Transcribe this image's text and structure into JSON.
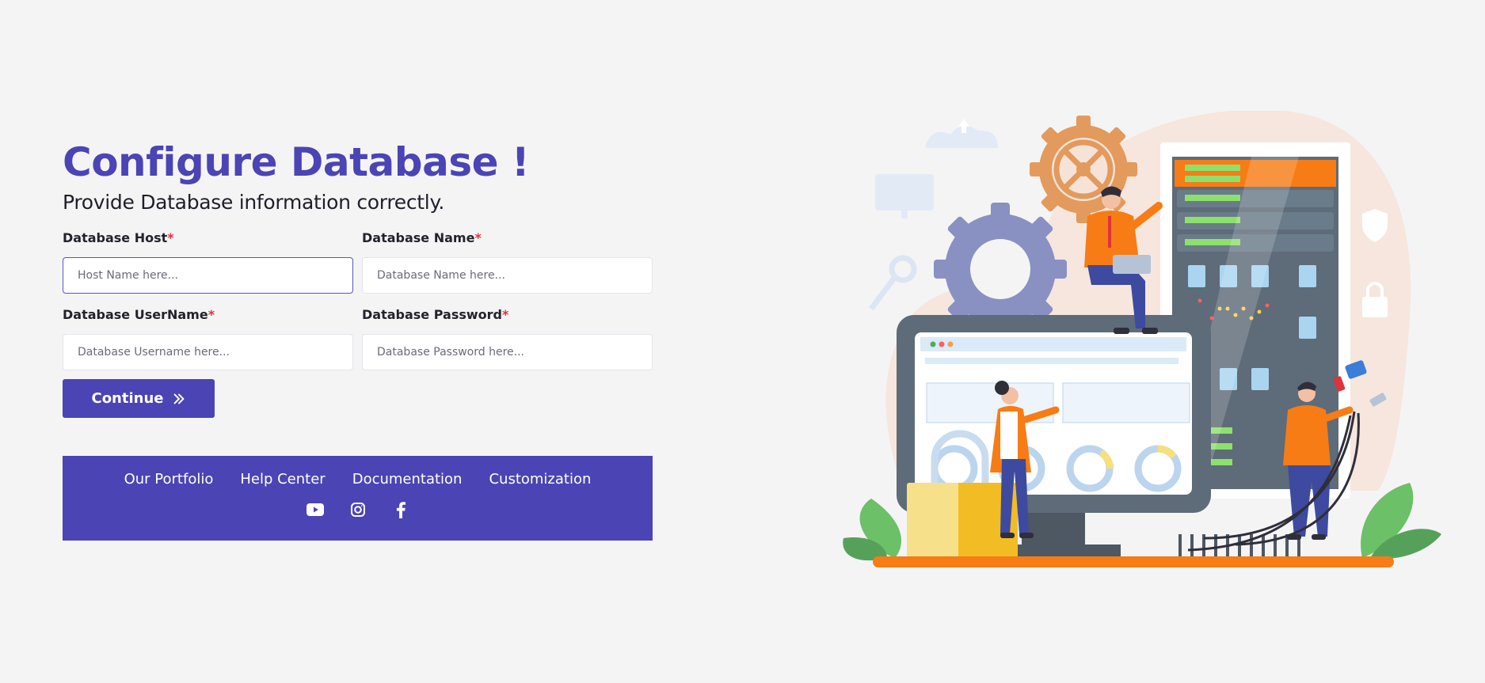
{
  "page": {
    "title": "Configure Database !",
    "subtitle": "Provide Database information correctly."
  },
  "form": {
    "host": {
      "label": "Database Host",
      "required": "*",
      "placeholder": "Host Name here...",
      "value": ""
    },
    "name": {
      "label": "Database Name",
      "required": "*",
      "placeholder": "Database Name here...",
      "value": ""
    },
    "username": {
      "label": "Database UserName",
      "required": "*",
      "placeholder": "Database Username here...",
      "value": ""
    },
    "password": {
      "label": "Database Password",
      "required": "*",
      "placeholder": "Database Password here...",
      "value": ""
    },
    "continue_label": "Continue"
  },
  "footer": {
    "links": [
      "Our Portfolio",
      "Help Center",
      "Documentation",
      "Customization"
    ],
    "social_icons": [
      "youtube-icon",
      "instagram-icon",
      "facebook-icon"
    ]
  },
  "colors": {
    "brand": "#4b44b5",
    "required": "#e0323a",
    "accent_orange": "#f77c15"
  },
  "illustration": {
    "icon": "server-database-illustration"
  }
}
